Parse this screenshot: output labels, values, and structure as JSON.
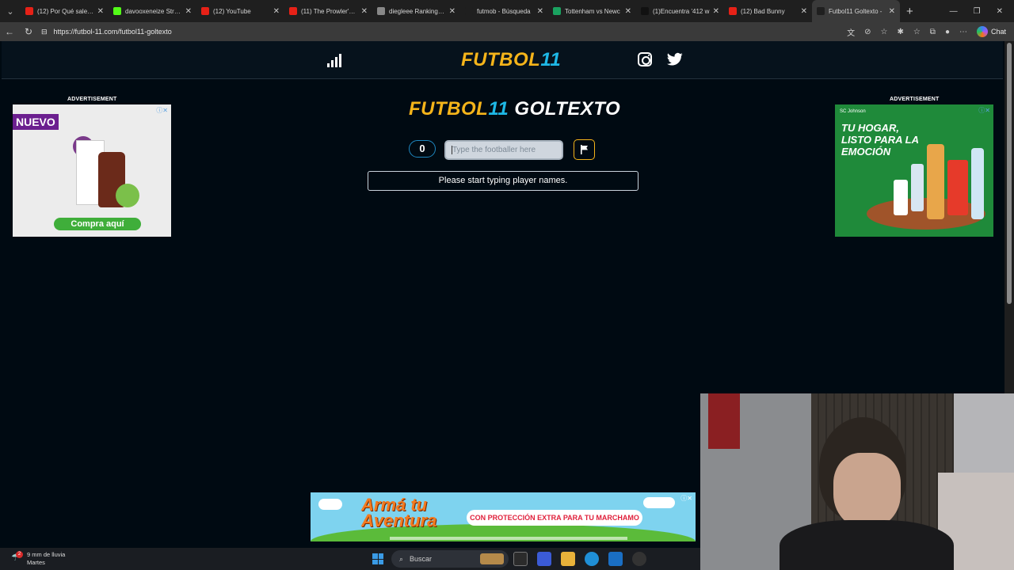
{
  "browser": {
    "tabs": [
      {
        "title": "(12) Por Qué sale CA",
        "favicon_color": "#e62117",
        "active": false
      },
      {
        "title": "davooxeneize Stream",
        "favicon_color": "#53fc18",
        "active": false
      },
      {
        "title": "(12) YouTube",
        "favicon_color": "#e62117",
        "active": false
      },
      {
        "title": "(11) The Prowler's Th",
        "favicon_color": "#e62117",
        "active": false
      },
      {
        "title": "diegleee Ranking | Tr",
        "favicon_color": "#888888",
        "active": false
      },
      {
        "title": "futmob - Búsqueda",
        "favicon_color": "#1f1f1f",
        "active": false
      },
      {
        "title": "Tottenham vs Newc",
        "favicon_color": "#1aa260",
        "active": false
      },
      {
        "title": "(1)Encuentra '412 w",
        "favicon_color": "#111111",
        "active": false
      },
      {
        "title": "(12) Bad Bunny",
        "favicon_color": "#e62117",
        "active": false
      },
      {
        "title": "Futbol11 Goltexto -",
        "favicon_color": "#1f1f1f",
        "active": true
      }
    ],
    "url": "https://futbol-11.com/futbol11-goltexto",
    "chat_label": "Chat"
  },
  "site": {
    "logo_part1": "FUTBOL",
    "logo_part2": "11",
    "game_title_part3": "GOLTEXTO",
    "score": "0",
    "input_placeholder": "Type the footballer here",
    "message": "Please start typing player names.",
    "advertisement_label": "ADVERTISEMENT"
  },
  "ads": {
    "left": {
      "badge": "NUEVO",
      "cta": "Compra aquí"
    },
    "right": {
      "brand": "SC Johnson",
      "headline": "TU HOGAR, LISTO PARA LA EMOCIÓN"
    },
    "bottom": {
      "headline": "Armá tu Aventura",
      "pill": "CON PROTECCIÓN EXTRA PARA TU MARCHAMO"
    }
  },
  "taskbar": {
    "weather_line1": "9 mm de lluvia",
    "weather_line2": "Martes",
    "weather_badge": "2",
    "search_label": "Buscar"
  }
}
